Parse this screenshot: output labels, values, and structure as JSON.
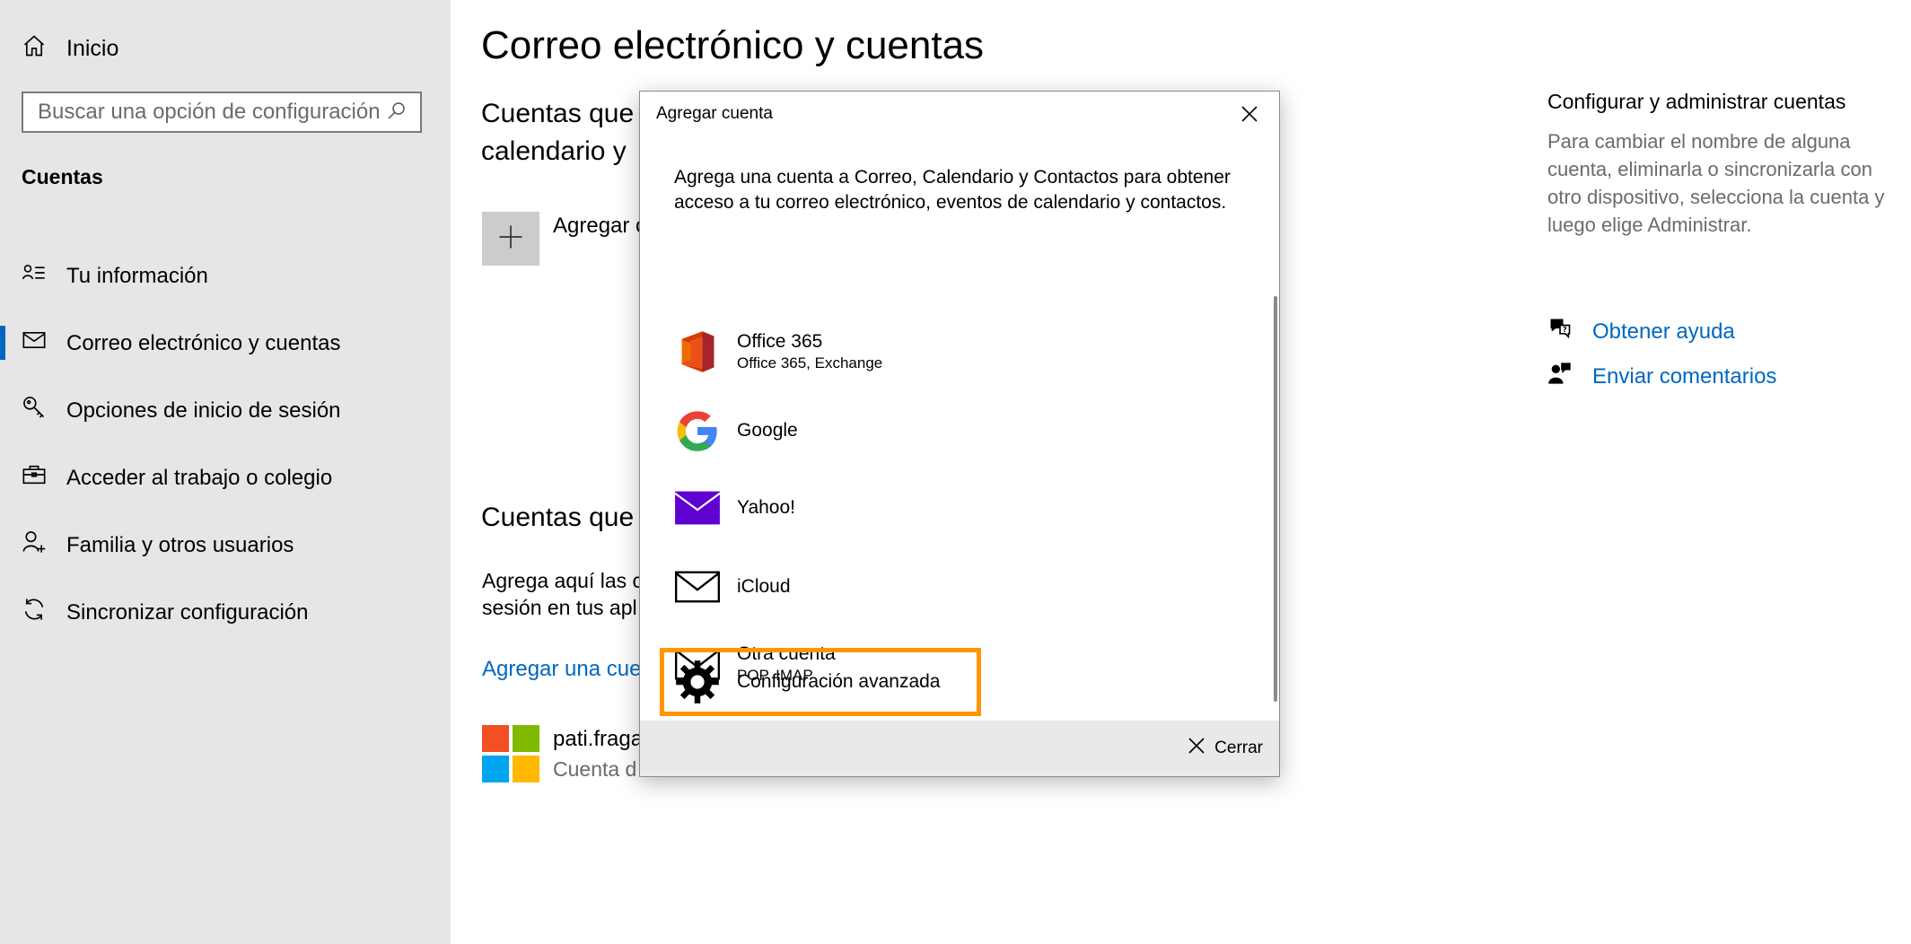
{
  "sidebar": {
    "home_label": "Inicio",
    "search_placeholder": "Buscar una opción de configuración",
    "section_label": "Cuentas",
    "items": [
      {
        "label": "Tu información",
        "icon": "person-card-icon"
      },
      {
        "label": "Correo electrónico y cuentas",
        "icon": "mail-icon",
        "selected": true
      },
      {
        "label": "Opciones de inicio de sesión",
        "icon": "key-icon"
      },
      {
        "label": "Acceder al trabajo o colegio",
        "icon": "briefcase-icon"
      },
      {
        "label": "Familia y otros usuarios",
        "icon": "add-person-icon"
      },
      {
        "label": "Sincronizar configuración",
        "icon": "sync-icon"
      }
    ]
  },
  "main": {
    "title": "Correo electrónico y cuentas",
    "section1_title_line1": "Cuentas que",
    "section1_title_line2": "calendario y",
    "add_label": "Agregar c",
    "section2_title": "Cuentas que",
    "section2_desc_line1": "Agrega aquí las c",
    "section2_desc_line2": "sesión en tus apl",
    "add_link": "Agregar una cue",
    "account_email": "pati.fraga",
    "account_type": "Cuenta d"
  },
  "right": {
    "title": "Configurar y administrar cuentas",
    "description": "Para cambiar el nombre de alguna cuenta, eliminarla o sincronizarla con otro dispositivo, selecciona la cuenta y luego elige Administrar.",
    "help_label": "Obtener ayuda",
    "feedback_label": "Enviar comentarios"
  },
  "dialog": {
    "title": "Agregar cuenta",
    "description": "Agrega una cuenta a Correo, Calendario y Contactos para obtener acceso a tu correo electrónico, eventos de calendario y contactos.",
    "providers": [
      {
        "name": "Office 365",
        "sub": "Office 365, Exchange",
        "icon": "office365-icon"
      },
      {
        "name": "Google",
        "sub": "",
        "icon": "google-icon"
      },
      {
        "name": "Yahoo!",
        "sub": "",
        "icon": "yahoo-icon"
      },
      {
        "name": "iCloud",
        "sub": "",
        "icon": "mail-outline-icon"
      },
      {
        "name": "Otra cuenta",
        "sub": "POP, IMAP",
        "icon": "mail-outline-icon"
      },
      {
        "name": "Configuración avanzada",
        "sub": "",
        "icon": "gear-icon"
      }
    ],
    "footer_close_label": "Cerrar"
  },
  "colors": {
    "accent": "#0067c0",
    "highlight": "#ff9500",
    "sidebar_bg": "#e6e6e6"
  }
}
